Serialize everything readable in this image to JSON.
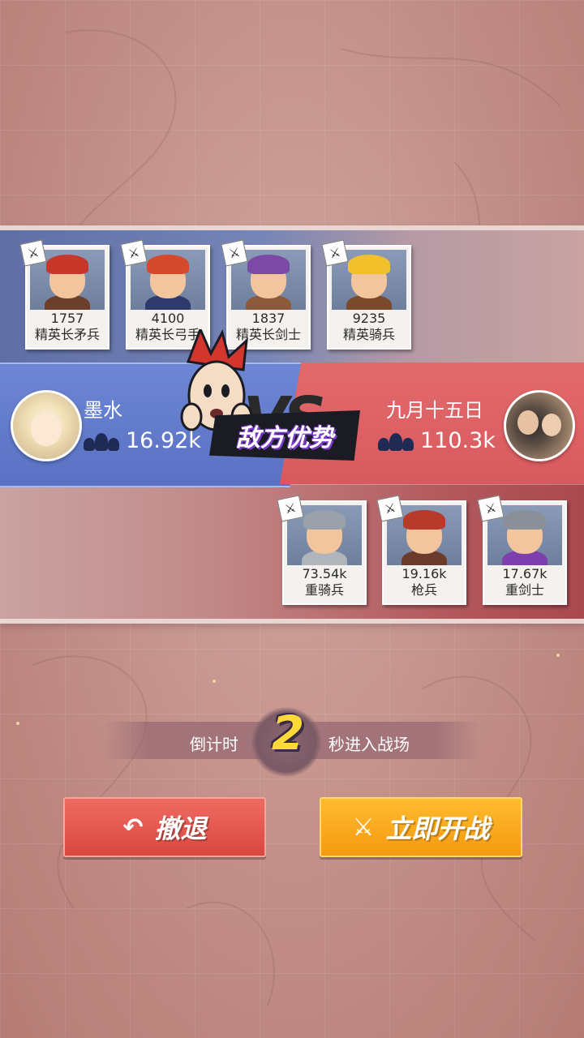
{
  "top_roster": [
    {
      "value": "1757",
      "name": "精英长矛兵",
      "hair": "#c7372a",
      "armor": "#6b3f2a"
    },
    {
      "value": "4100",
      "name": "精英长弓手",
      "hair": "#d54a2c",
      "armor": "#2f3a6c"
    },
    {
      "value": "1837",
      "name": "精英长剑士",
      "hair": "#7b4aa6",
      "armor": "#8a5a3a"
    },
    {
      "value": "9235",
      "name": "精英骑兵",
      "hair": "#f2c02a",
      "armor": "#7a4a2a"
    }
  ],
  "left_player": {
    "name": "墨水",
    "power": "16.92k"
  },
  "right_player": {
    "name": "九月十五日",
    "power": "110.3k"
  },
  "vs": {
    "glyph": "VS",
    "status_banner": "敌方优势"
  },
  "bottom_roster": [
    {
      "value": "73.54k",
      "name": "重骑兵",
      "hair": "#9aa1ab",
      "armor": "#b0b4bb"
    },
    {
      "value": "19.16k",
      "name": "枪兵",
      "hair": "#b83a2a",
      "armor": "#6a3a2a"
    },
    {
      "value": "17.67k",
      "name": "重剑士",
      "hair": "#8a8f98",
      "armor": "#7d3fae"
    }
  ],
  "countdown": {
    "prefix": "倒计时",
    "number": "2",
    "suffix": "秒进入战场"
  },
  "buttons": {
    "retreat": "撤退",
    "fight": "立即开战"
  },
  "icons": {
    "retreat": "undo-arrow-icon",
    "fight": "crossed-swords-icon",
    "unit_type": "sword-icon",
    "players": "users-icon"
  },
  "colors": {
    "blue_team": "#5a71c4",
    "red_team": "#d85a5e",
    "countdown_digit": "#ffd83a",
    "retreat_button": "#d9473f",
    "fight_button": "#f59a12"
  }
}
